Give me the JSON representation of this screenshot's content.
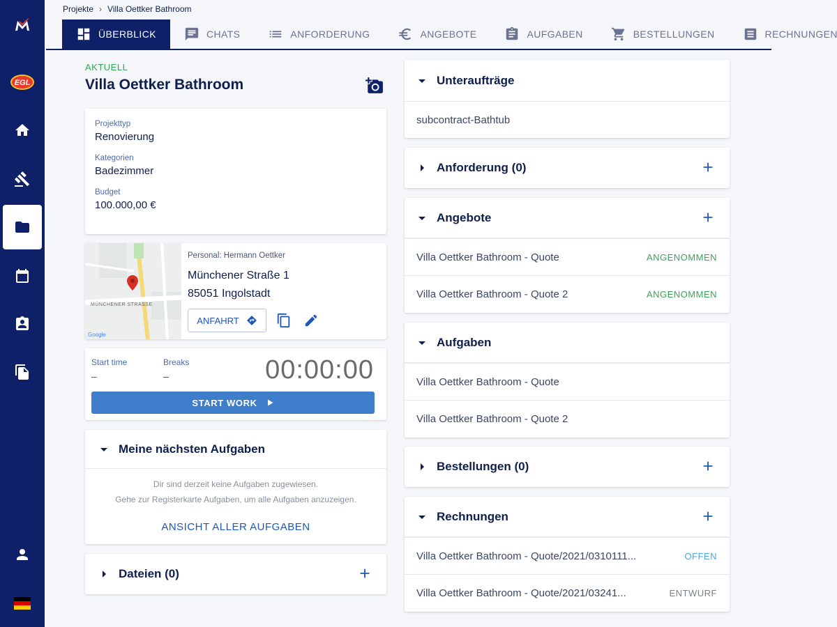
{
  "breadcrumb": {
    "root": "Projekte",
    "separator": "›",
    "current": "Villa Oettker Bathroom"
  },
  "tabs": [
    {
      "label": "Überblick",
      "icon": "dashboard-icon",
      "active": true
    },
    {
      "label": "Chats",
      "icon": "chat-icon"
    },
    {
      "label": "Anforderung",
      "icon": "list-icon"
    },
    {
      "label": "Angebote",
      "icon": "euro-icon"
    },
    {
      "label": "Aufgaben",
      "icon": "clipboard-icon"
    },
    {
      "label": "Bestellungen",
      "icon": "cart-icon"
    },
    {
      "label": "Rechnungen",
      "icon": "receipt-icon"
    }
  ],
  "sidebar": {
    "items": [
      "logo-icon",
      "egl-logo",
      "home-icon",
      "gavel-icon",
      "folder-icon",
      "calendar-icon",
      "assignment-icon",
      "files-icon",
      "person-icon",
      "flag-de-icon"
    ],
    "active": "folder-icon"
  },
  "project": {
    "status": "AKTUELL",
    "title": "Villa Oettker Bathroom",
    "fields": [
      {
        "label": "Projekttyp",
        "value": "Renovierung"
      },
      {
        "label": "Kategorien",
        "value": "Badezimmer"
      },
      {
        "label": "Budget",
        "value": "100.000,00 €"
      }
    ]
  },
  "address": {
    "person": "Personal: Hermann Oettker",
    "street": "Münchener Straße 1",
    "city": "85051 Ingolstadt",
    "route_button": "ANFAHRT",
    "map_street_label": "MÜNCHENER STRASSE"
  },
  "timer": {
    "start_label": "Start time",
    "start_value": "–",
    "breaks_label": "Breaks",
    "breaks_value": "–",
    "clock": "00:00:00",
    "start_button": "START WORK"
  },
  "my_tasks": {
    "title": "Meine nächsten Aufgaben",
    "empty_line1": "Dir sind derzeit keine Aufgaben zugewiesen.",
    "empty_line2": "Gehe zur Registerkarte Aufgaben, um alle Aufgaben anzuzeigen.",
    "link": "ANSICHT ALLER AUFGABEN"
  },
  "files": {
    "title": "Dateien (0)"
  },
  "right": {
    "subcontracts": {
      "title": "Unteraufträge",
      "items": [
        "subcontract-Bathtub"
      ]
    },
    "requirements": {
      "title": "Anforderung (0)"
    },
    "quotes": {
      "title": "Angebote",
      "items": [
        {
          "name": "Villa Oettker Bathroom - Quote",
          "status": "ANGENOMMEN"
        },
        {
          "name": "Villa Oettker Bathroom - Quote 2",
          "status": "ANGENOMMEN"
        }
      ]
    },
    "tasks": {
      "title": "Aufgaben",
      "items": [
        "Villa Oettker Bathroom - Quote",
        "Villa Oettker Bathroom - Quote 2"
      ]
    },
    "orders": {
      "title": "Bestellungen (0)"
    },
    "invoices": {
      "title": "Rechnungen",
      "items": [
        {
          "name": "Villa Oettker Bathroom - Quote/2021/0310111...",
          "status": "OFFEN"
        },
        {
          "name": "Villa Oettker Bathroom - Quote/2021/03241...",
          "status": "ENTWURF"
        }
      ]
    }
  },
  "colors": {
    "navy": "#0e2168",
    "accent_blue": "#1e57b8",
    "button_blue": "#3d7dc9",
    "success_green": "#3aa35a",
    "open_blue": "#4da3e0",
    "draft_gray": "#7a7f8c"
  }
}
